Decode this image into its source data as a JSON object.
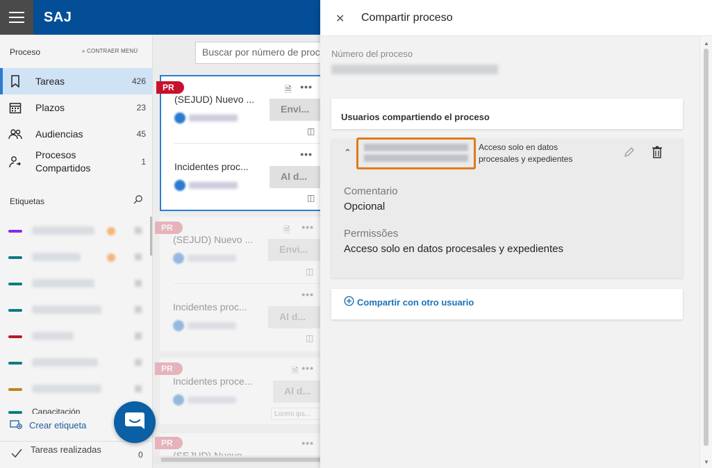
{
  "app": {
    "name": "SAJ"
  },
  "sidebar": {
    "header": "Proceso",
    "collapse_label": "CONTRAER MENÚ",
    "items": [
      {
        "label": "Tareas",
        "count": "426",
        "icon": "bookmark-icon"
      },
      {
        "label": "Plazos",
        "count": "23",
        "icon": "calendar-icon"
      },
      {
        "label": "Audiencias",
        "count": "45",
        "icon": "people-icon"
      },
      {
        "label": "Procesos\nCompartidos",
        "count": "1",
        "icon": "shared-user-icon"
      }
    ],
    "tags_title": "Etiquetas",
    "tag_colors": [
      "#8a2be2",
      "#0e7a86",
      "#0e7a86",
      "#0e7a86",
      "#b31b2c",
      "#0e7a86",
      "#c28414"
    ],
    "partial_tag": "Capacitación",
    "create_tag": "Crear etiqueta",
    "done_label": "Tareas realizadas",
    "done_count": "0"
  },
  "task_list": {
    "search_placeholder": "Buscar por número de proceso",
    "badge": "PR",
    "cards": [
      {
        "title": "(SEJUD) Nuevo ...",
        "button": "Envi..."
      },
      {
        "title": "Incidentes proc...",
        "button": "Al d..."
      },
      {
        "title": "(SEJUD) Nuevo ...",
        "button": "Envi..."
      },
      {
        "title": "Incidentes proc...",
        "button": "Al d..."
      },
      {
        "title": "Incidentes proce...",
        "button": "Al d..."
      },
      {
        "title": "(SEJUD) Nuevo ...",
        "button": ""
      }
    ],
    "lorem": "Lorem ips..."
  },
  "panel": {
    "title": "Compartir proceso",
    "process_number_label": "Número del proceso",
    "users_title": "Usuarios compartiendo el proceso",
    "user": {
      "access": "Acceso solo en datos procesales y expedientes",
      "comment_label": "Comentario",
      "comment_value": "Opcional",
      "permissions_label": "Permissões",
      "permissions_value": "Acceso solo en datos procesales y expedientes"
    },
    "share_button": "Compartir con otro usuario"
  },
  "colors": {
    "topbar": "#034e96",
    "accent": "#2b7bd1",
    "badge": "#c8102e",
    "highlight": "#e07b1a"
  }
}
